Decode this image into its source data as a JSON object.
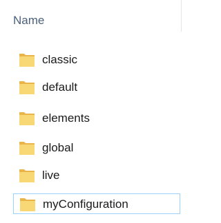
{
  "header": {
    "column_name": "Name"
  },
  "folders": [
    {
      "label": "classic",
      "icon": "folder-icon"
    },
    {
      "label": "default",
      "icon": "folder-icon"
    },
    {
      "label": "elements",
      "icon": "folder-icon"
    },
    {
      "label": "global",
      "icon": "folder-icon"
    },
    {
      "label": "live",
      "icon": "folder-icon"
    },
    {
      "label": "myConfiguration",
      "icon": "folder-icon",
      "selected": true
    }
  ],
  "colors": {
    "header_text": "#4c607a",
    "folder_body": "#f8d775",
    "folder_tab": "#e9b548",
    "selection_border": "#99d1ff"
  }
}
